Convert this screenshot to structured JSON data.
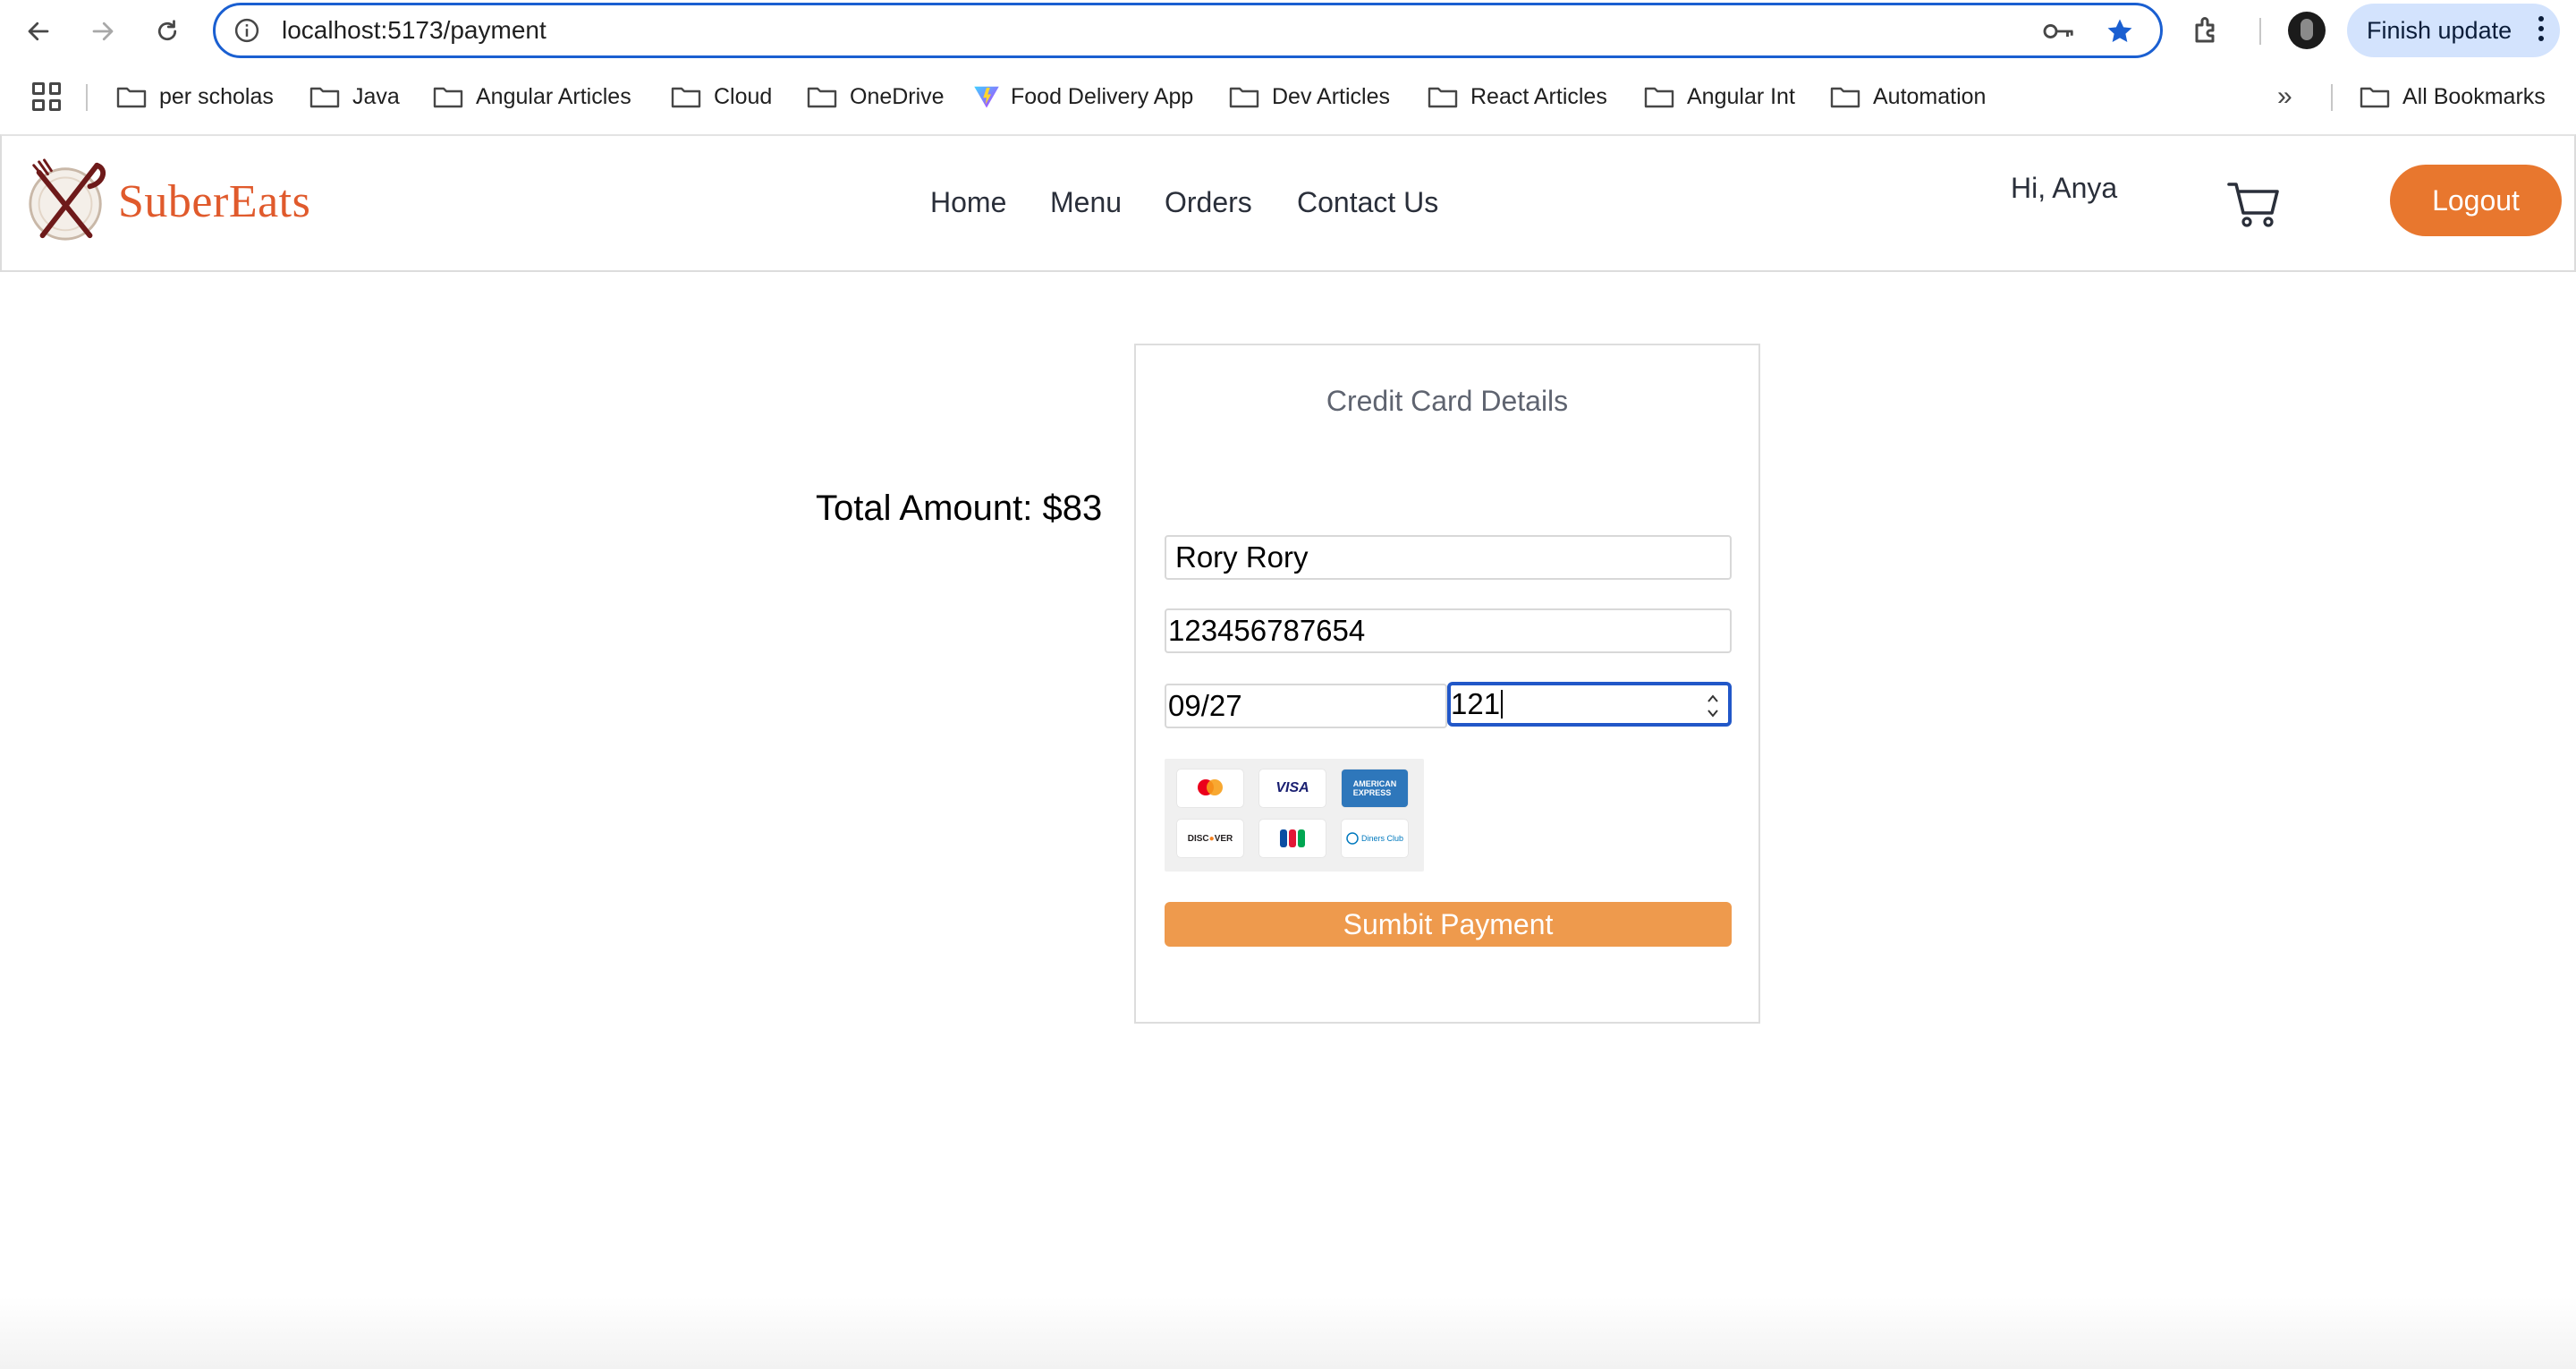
{
  "browser": {
    "url": "localhost:5173/payment",
    "finish_update_label": "Finish update",
    "bookmarks": [
      {
        "label": "per scholas",
        "icon": "folder-icon"
      },
      {
        "label": "Java",
        "icon": "folder-icon"
      },
      {
        "label": "Angular Articles",
        "icon": "folder-icon"
      },
      {
        "label": "Cloud",
        "icon": "folder-icon"
      },
      {
        "label": "OneDrive",
        "icon": "folder-icon"
      },
      {
        "label": "Food Delivery App",
        "icon": "vite-icon"
      },
      {
        "label": "Dev Articles",
        "icon": "folder-icon"
      },
      {
        "label": "React Articles",
        "icon": "folder-icon"
      },
      {
        "label": "Angular Int",
        "icon": "folder-icon"
      },
      {
        "label": "Automation",
        "icon": "folder-icon"
      }
    ],
    "all_bookmarks_label": "All Bookmarks"
  },
  "site": {
    "brand": "SuberEats",
    "nav": [
      "Home",
      "Menu",
      "Orders",
      "Contact Us"
    ],
    "greeting": "Hi, Anya",
    "logout_label": "Logout",
    "colors": {
      "brand": "#e05a2c",
      "accent": "#e8772e",
      "submit": "#ee9a4d"
    }
  },
  "payment": {
    "total_label": "Total Amount: $83",
    "card_title": "Credit Card Details",
    "name_value": "Rory Rory",
    "number_value": "123456787654",
    "expiry_value": "09/27",
    "cvc_value": "121",
    "card_brands": [
      "Mastercard",
      "VISA",
      "American Express",
      "DISCOVER",
      "JCB",
      "Diners Club"
    ],
    "submit_label": "Sumbit Payment"
  }
}
